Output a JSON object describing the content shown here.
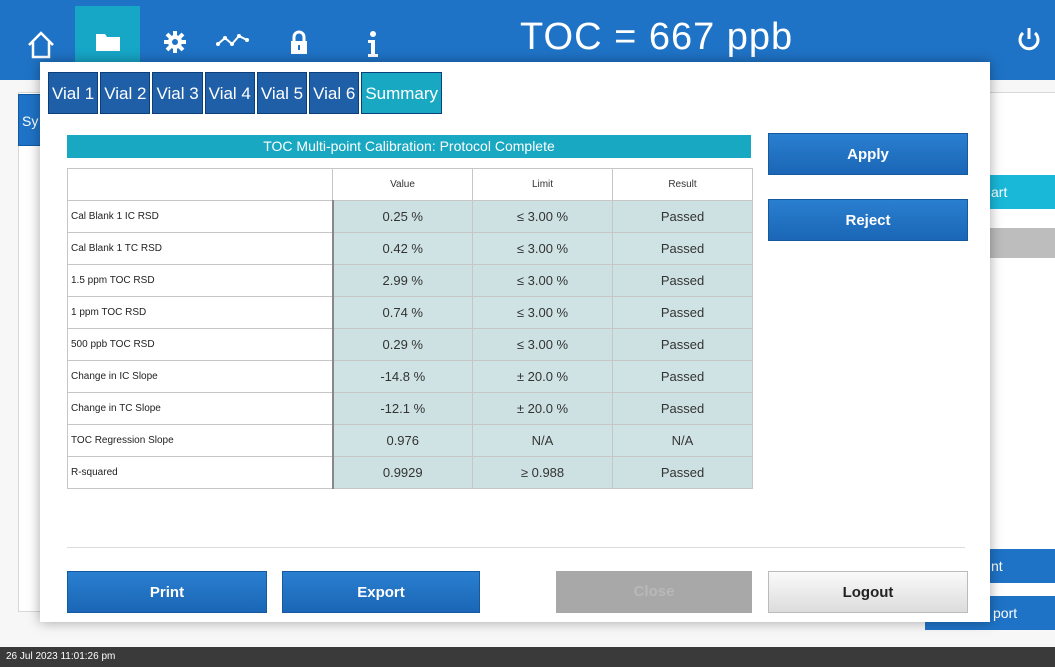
{
  "topbar": {
    "toc_label": "TOC = 667 ppb",
    "nav": [
      {
        "icon": "home-icon"
      },
      {
        "icon": "folder-icon"
      },
      {
        "icon": "gear-icon"
      },
      {
        "icon": "graph-icon"
      },
      {
        "icon": "lock-icon"
      },
      {
        "icon": "info-icon"
      }
    ],
    "power_icon": "power-icon",
    "colors": {
      "bar": "#1f73c6",
      "active": "#16a6c6"
    }
  },
  "background": {
    "tab_label": "Sy",
    "right_buttons": [
      "art",
      "nt",
      "port"
    ]
  },
  "tabs": [
    {
      "label": "Vial 1",
      "active": false
    },
    {
      "label": "Vial 2",
      "active": false
    },
    {
      "label": "Vial 3",
      "active": false
    },
    {
      "label": "Vial 4",
      "active": false
    },
    {
      "label": "Vial 5",
      "active": false
    },
    {
      "label": "Vial 6",
      "active": false
    },
    {
      "label": "Summary",
      "active": true
    }
  ],
  "summary": {
    "banner": "TOC Multi-point Calibration: Protocol Complete",
    "columns": [
      "",
      "Value",
      "Limit",
      "Result"
    ],
    "rows": [
      {
        "name": "Cal Blank 1 IC RSD",
        "value": "0.25 %",
        "limit": "≤ 3.00 %",
        "result": "Passed"
      },
      {
        "name": "Cal Blank 1 TC RSD",
        "value": "0.42 %",
        "limit": "≤ 3.00 %",
        "result": "Passed"
      },
      {
        "name": "1.5 ppm TOC RSD",
        "value": "2.99 %",
        "limit": "≤ 3.00 %",
        "result": "Passed"
      },
      {
        "name": "1 ppm TOC RSD",
        "value": "0.74 %",
        "limit": "≤ 3.00 %",
        "result": "Passed"
      },
      {
        "name": "500 ppb TOC RSD",
        "value": "0.29 %",
        "limit": "≤ 3.00 %",
        "result": "Passed"
      },
      {
        "name": "Change in IC Slope",
        "value": "-14.8 %",
        "limit": "± 20.0 %",
        "result": "Passed"
      },
      {
        "name": "Change in TC Slope",
        "value": "-12.1 %",
        "limit": "± 20.0 %",
        "result": "Passed"
      },
      {
        "name": "TOC Regression Slope",
        "value": "0.976",
        "limit": "N/A",
        "result": "N/A"
      },
      {
        "name": "R-squared",
        "value": "0.9929",
        "limit": "≥ 0.988",
        "result": "Passed"
      }
    ]
  },
  "buttons": {
    "apply": "Apply",
    "reject": "Reject",
    "print": "Print",
    "export": "Export",
    "close": "Close",
    "logout": "Logout"
  },
  "status_bar": {
    "datetime": "26 Jul 2023 11:01:26 pm"
  }
}
